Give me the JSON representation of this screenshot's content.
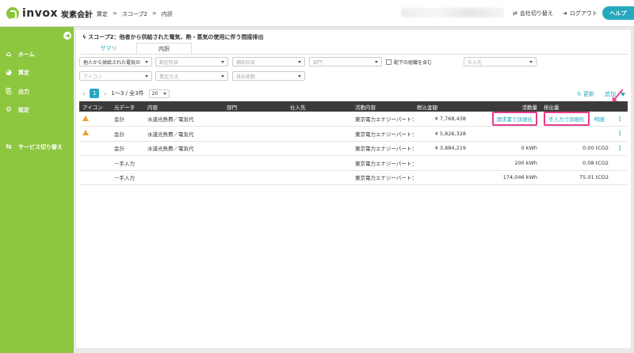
{
  "header": {
    "logo_text": "invox",
    "logo_sub": "炭素会計",
    "breadcrumb": [
      "算定",
      ">",
      "スコープ2",
      ">",
      "内訳"
    ],
    "switch_company": "会社切り替え",
    "logout": "ログアウト",
    "help": "ヘルプ"
  },
  "sidebar": {
    "items": [
      {
        "label": "ホーム",
        "icon": "home-icon"
      },
      {
        "label": "算定",
        "icon": "pie-chart-icon"
      },
      {
        "label": "出力",
        "icon": "export-icon"
      },
      {
        "label": "設定",
        "icon": "gear-icon"
      },
      {
        "label": "サービス切り替え",
        "icon": "switch-icon"
      }
    ]
  },
  "page": {
    "title": "スコープ2：他者から供給された電気、熱・蒸気の使用に伴う間接排出",
    "tabs": [
      "サマリ",
      "内訳"
    ]
  },
  "filters": {
    "category": "他人から供給された電気の",
    "account": "勘定科目",
    "sub_account": "補助科目",
    "department": "部門",
    "include_sub": "配下の組織を含む",
    "supplier": "仕入先",
    "icon": "アイコン",
    "calc_method": "算定方法",
    "emission_factor": "排出係数"
  },
  "pager": {
    "current": "1",
    "summary": "1〜3 / 全3件",
    "page_size": "20"
  },
  "actions": {
    "update": "更新",
    "add": "追加"
  },
  "table": {
    "columns": [
      "アイコン",
      "元データ",
      "内容",
      "部門",
      "仕入先",
      "活動内容",
      "税込金額",
      "活動量",
      "排出量",
      ""
    ],
    "rows": [
      {
        "warn": true,
        "source": "会計",
        "content": "水道光熱費／電気代",
        "dept": "",
        "supplier": "",
        "activity": "東京電力エナジーパートナ",
        "amount": "¥ 7,768,438",
        "btn1": "請求書で詳細化",
        "btn2": "手入力で詳細化",
        "btn3": "明細",
        "qty": "",
        "emission": ""
      },
      {
        "warn": true,
        "source": "会計",
        "content": "水道光熱費／電気代",
        "dept": "",
        "supplier": "",
        "activity": "東京電力エナジーパートナ",
        "amount": "¥ 5,826,328",
        "qty": "",
        "emission": ""
      },
      {
        "warn": false,
        "source": "会計",
        "content": "水道光熱費／電気代",
        "dept": "",
        "supplier": "",
        "activity": "東京電力エナジーパートナ",
        "amount": "¥ 3,884,219",
        "qty": "0 kWh",
        "emission": "0.00 tCO2"
      },
      {
        "warn": false,
        "source": "－手入力",
        "content": "",
        "dept": "",
        "supplier": "",
        "activity": "東京電力エナジーパートナ",
        "amount": "",
        "qty": "200 kWh",
        "emission": "0.08 tCO2"
      },
      {
        "warn": false,
        "source": "－手入力",
        "content": "",
        "dept": "",
        "supplier": "",
        "activity": "東京電力エナジーパートナ",
        "amount": "",
        "qty": "174,046 kWh",
        "emission": "75.01 tCO2"
      }
    ]
  },
  "colors": {
    "brand_green": "#8dc63f",
    "accent_teal": "#26a9bf",
    "highlight_pink": "#e83e8c",
    "warning_orange": "#f0a030"
  }
}
